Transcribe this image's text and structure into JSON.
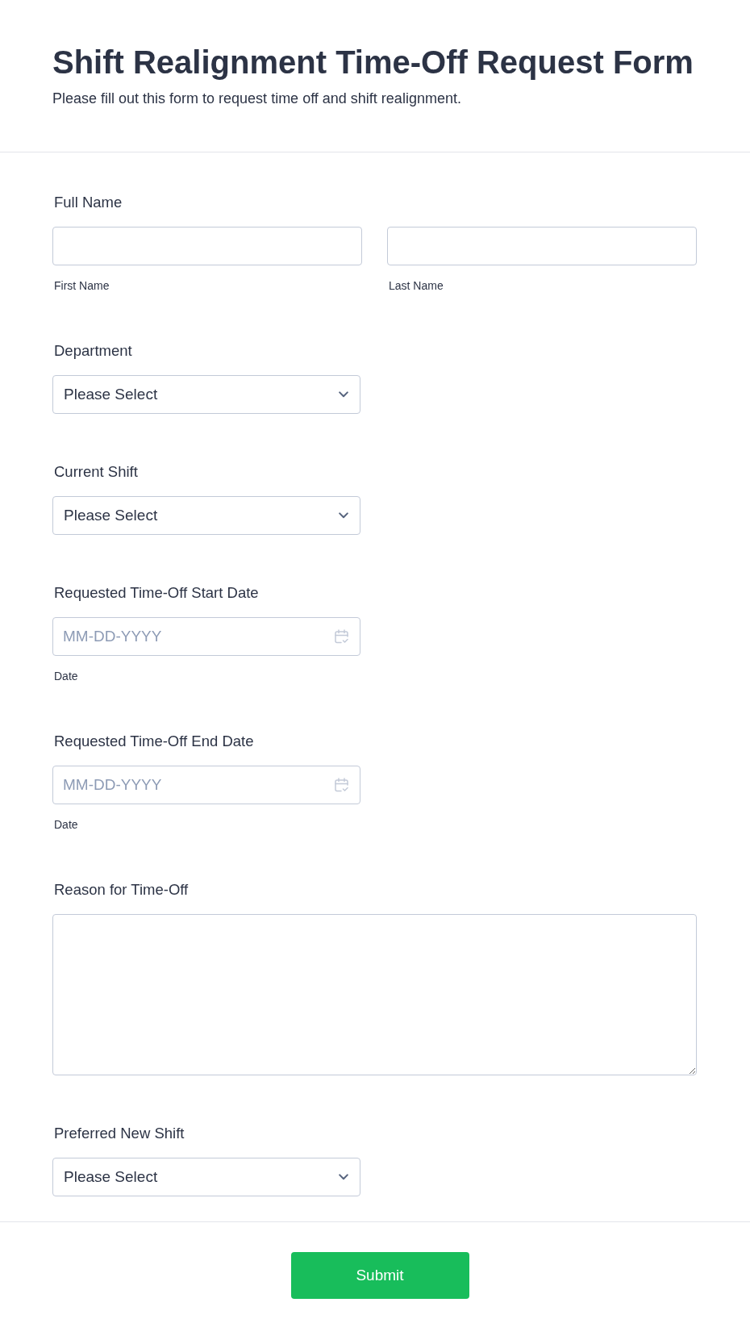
{
  "header": {
    "title": "Shift Realignment Time-Off Request Form",
    "description": "Please fill out this form to request time off and shift realignment."
  },
  "fields": [
    {
      "kind": "name",
      "label": "Full Name",
      "parts": [
        {
          "sublabel": "First Name"
        },
        {
          "sublabel": "Last Name"
        }
      ]
    },
    {
      "kind": "select",
      "label": "Department",
      "value": "Please Select"
    },
    {
      "kind": "select",
      "label": "Current Shift",
      "value": "Please Select"
    },
    {
      "kind": "date",
      "label": "Requested Time-Off Start Date",
      "placeholder": "MM-DD-YYYY",
      "sublabel": "Date"
    },
    {
      "kind": "date",
      "label": "Requested Time-Off End Date",
      "placeholder": "MM-DD-YYYY",
      "sublabel": "Date"
    },
    {
      "kind": "textarea",
      "label": "Reason for Time-Off"
    },
    {
      "kind": "select",
      "label": "Preferred New Shift",
      "value": "Please Select"
    }
  ],
  "submit": {
    "label": "Submit"
  }
}
